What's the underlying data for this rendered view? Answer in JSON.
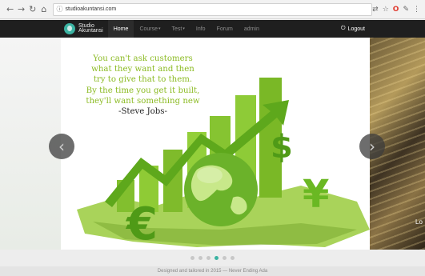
{
  "browser": {
    "url": "studioakuntansi.com"
  },
  "navbar": {
    "logo_line1": "Studio",
    "logo_line2": "Akuntansi",
    "menu": [
      {
        "label": "Home",
        "active": true,
        "caret": ""
      },
      {
        "label": "Course",
        "active": false,
        "caret": "▾"
      },
      {
        "label": "Test",
        "active": false,
        "caret": "▾"
      },
      {
        "label": "Info",
        "active": false,
        "caret": ""
      },
      {
        "label": "Forum",
        "active": false,
        "caret": ""
      },
      {
        "label": "admin",
        "active": false,
        "caret": ""
      }
    ],
    "logout": "Logout"
  },
  "carousel": {
    "quote_lines": [
      "You can't ask customers",
      "what they want and then",
      "try to give that to them.",
      "By the time you get it built,",
      "they'll want something new"
    ],
    "author": "-Steve Jobs-",
    "right_slide_text": "Lo",
    "active_index": 3,
    "dot_count": 6
  },
  "footer": {
    "text": "Designed and tailored in 2015 — Never Ending Ada"
  },
  "colors": {
    "accent": "#3bb3a2",
    "quote": "#8cbb24",
    "navbar": "#1f1f1f"
  }
}
